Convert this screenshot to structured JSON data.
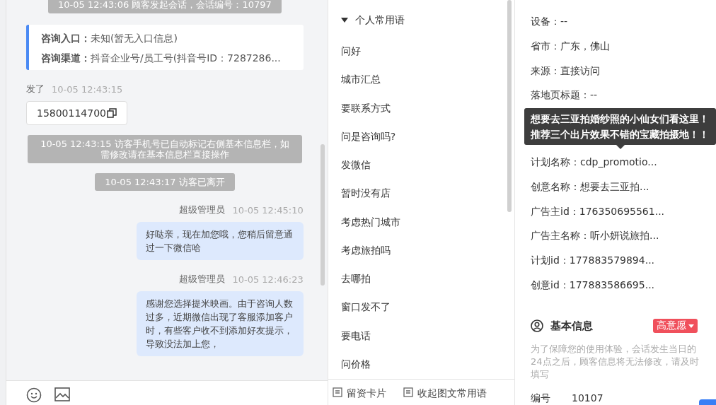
{
  "chat": {
    "messages": [
      {
        "kind": "system",
        "text": "10-05 12:43:06 顾客发起会话，会话编号：10797"
      },
      {
        "kind": "source",
        "lines": [
          {
            "label": "咨询入口：",
            "value": "未知(暂无入口信息)"
          },
          {
            "label": "咨询渠道：",
            "value": "抖音企业号/员工号(抖音号ID：7287286..."
          }
        ]
      },
      {
        "kind": "visitor",
        "sender": "发了",
        "time": "10-05 12:43:15",
        "text": "15800114700"
      },
      {
        "kind": "system",
        "text": "10-05 12:43:15 访客手机号已自动标记右侧基本信息栏，如需修改请在基本信息栏直接操作"
      },
      {
        "kind": "system",
        "text": "10-05 12:43:17 访客已离开"
      },
      {
        "kind": "agent",
        "sender": "超级管理员",
        "time": "10-05 12:45:10",
        "text": "好哒亲，现在加您哦，您稍后留意通过一下微信哈"
      },
      {
        "kind": "agent",
        "sender": "超级管理员",
        "time": "10-05 12:46:23",
        "text": "感谢您选择提米映画。由于咨询人数过多，近期微信出现了客服添加客户时，有些客户收不到添加好友提示，导致没法加上您，"
      }
    ]
  },
  "quick_replies": {
    "group": {
      "title": "个人常用语",
      "expanded": true
    },
    "items": [
      "问好",
      "城市汇总",
      "要联系方式",
      "问是咨询吗?",
      "发微信",
      "暂时没有店",
      "考虑热门城市",
      "考虑旅拍吗",
      "去哪拍",
      "窗口发不了",
      "要电话",
      "问价格"
    ],
    "footer": [
      "留资卡片",
      "收起图文常用语"
    ]
  },
  "details": {
    "fields": [
      "设备：--",
      "省市：广东，佛山",
      "来源：直接访问",
      "落地页标题：--"
    ],
    "tooltip": "想要去三亚拍婚纱照的小仙女们看这里！推荐三个出片效果不错的宝藏拍摄地！！",
    "fields_below": [
      "计划名称：cdp_promotio...",
      "创意名称：想要去三亚拍...",
      "广告主id：176350695561...",
      "广告主名称：听小妍说旅拍...",
      "计划id：177883579894...",
      "创意id：177883586695..."
    ],
    "basic_info": {
      "title": "基本信息",
      "tag": "高意愿",
      "notice": "为了保障您的使用体验，会话发生当日的24点之后，顾客信息将无法修改，请及时填写",
      "rows": [
        {
          "label": "编号",
          "value": "10107"
        }
      ]
    }
  }
}
